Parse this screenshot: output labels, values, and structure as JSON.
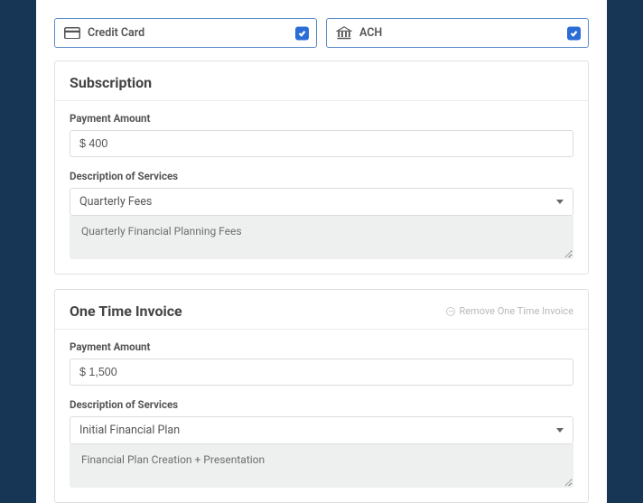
{
  "payment_methods": {
    "credit_card": {
      "label": "Credit Card",
      "checked": true
    },
    "ach": {
      "label": "ACH",
      "checked": true
    }
  },
  "subscription": {
    "title": "Subscription",
    "amount_label": "Payment Amount",
    "amount_value": "$ 400",
    "desc_label": "Description of Services",
    "desc_select_value": "Quarterly Fees",
    "desc_text": "Quarterly Financial Planning Fees"
  },
  "one_time": {
    "title": "One Time Invoice",
    "remove_label": "Remove One Time Invoice",
    "amount_label": "Payment Amount",
    "amount_value": "$ 1,500",
    "desc_label": "Description of Services",
    "desc_select_value": "Initial Financial Plan",
    "desc_text": "Financial Plan Creation + Presentation"
  }
}
